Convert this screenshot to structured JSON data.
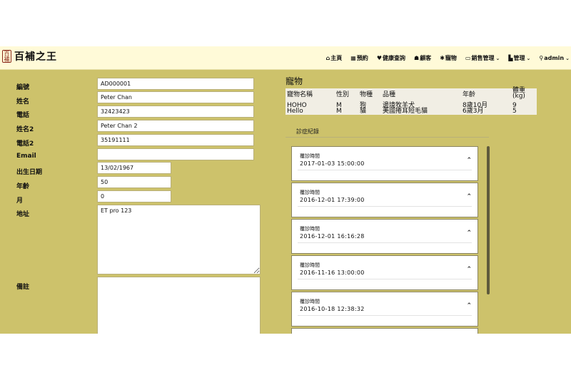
{
  "brand": {
    "seal": "百補",
    "name": "百補之王"
  },
  "nav": [
    {
      "icon": "⌂",
      "label": "主頁",
      "caret": ""
    },
    {
      "icon": "▦",
      "label": "預約",
      "caret": ""
    },
    {
      "icon": "♥",
      "label": "健康查詢",
      "caret": ""
    },
    {
      "icon": "☗",
      "label": "顧客",
      "caret": ""
    },
    {
      "icon": "✱",
      "label": "寵物",
      "caret": ""
    },
    {
      "icon": "▭",
      "label": "銷售管理",
      "caret": "⌄"
    },
    {
      "icon": "▙",
      "label": "管理",
      "caret": "⌄"
    },
    {
      "icon": "⚲",
      "label": "admin",
      "caret": "⌄"
    }
  ],
  "form": {
    "labels": {
      "code": "編號",
      "name": "姓名",
      "phone": "電話",
      "name2": "姓名2",
      "phone2": "電話2",
      "email": "Email",
      "dob": "出生日期",
      "age": "年齡",
      "month": "月",
      "address": "地址",
      "remark": "備註"
    },
    "values": {
      "code": "AD000001",
      "name": "Peter Chan",
      "phone": "32423423",
      "name2": "Peter Chan 2",
      "phone2": "35191111",
      "email": "",
      "dob": "13/02/1967",
      "age": "50",
      "month": "0",
      "address": "ET pro 123",
      "remark": ""
    }
  },
  "pets": {
    "title": "寵物",
    "columns": [
      "寵物名稱",
      "性別",
      "物種",
      "品種",
      "年齡",
      "體重(kg)"
    ],
    "weight_col_line1": "體重",
    "weight_col_line2": "(kg)",
    "rows": [
      [
        "HOHO",
        "M",
        "狗",
        "邊境牧羊犬",
        "8歲10月",
        "9"
      ],
      [
        "Hello",
        "M",
        "貓",
        "美國捲耳短毛貓",
        "6歲3月",
        "5"
      ]
    ]
  },
  "diagnosis": {
    "title": "診症紀錄",
    "records": [
      {
        "label": "覆診時間",
        "datetime": "2017-01-03 15:00:00"
      },
      {
        "label": "覆診時間",
        "datetime": "2016-12-01 17:39:00"
      },
      {
        "label": "覆診時間",
        "datetime": "2016-12-01 16:16:28"
      },
      {
        "label": "覆診時間",
        "datetime": "2016-11-16 13:00:00"
      },
      {
        "label": "覆診時間",
        "datetime": "2016-10-18 12:38:32"
      }
    ]
  },
  "colors": {
    "page_bg": "#cdc26b",
    "navbar_bg": "#fffad8",
    "card_border": "#8a8460"
  }
}
